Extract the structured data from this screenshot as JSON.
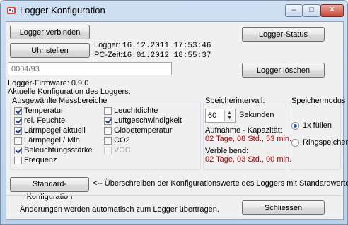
{
  "window": {
    "title": "Logger Konfiguration",
    "minimize_label": "–",
    "maximize_label": "□",
    "close_label": "✕"
  },
  "connect_button": "Logger verbinden",
  "status_button": "Logger-Status",
  "set_clock_button": "Uhr stellen",
  "clock": {
    "logger_label": "Logger:",
    "logger_value": "16.12.2011 17:53:46",
    "pc_label": "PC-Zeit:",
    "pc_value": "16.01.2012 18:55:37"
  },
  "id_field": {
    "value": "0004/93"
  },
  "clear_button": "Logger löschen",
  "firmware": "Logger-Firmware: 0.9.0",
  "config_label": "Aktuelle Konfiguration des Loggers:",
  "measurement": {
    "title": "Ausgewählte Messbereiche",
    "left": [
      {
        "label": "Temperatur",
        "checked": true
      },
      {
        "label": "rel. Feuchte",
        "checked": true
      },
      {
        "label": "Lärmpegel aktuell",
        "checked": true
      },
      {
        "label": "Lärmpegel / Min",
        "checked": false
      },
      {
        "label": "Beleuchtungsstärke",
        "checked": true
      },
      {
        "label": "Frequenz",
        "checked": false
      }
    ],
    "right": [
      {
        "label": "Leuchtdichte",
        "checked": false,
        "disabled": false
      },
      {
        "label": "Luftgeschwindigkeit",
        "checked": true,
        "disabled": false
      },
      {
        "label": "Globetemperatur",
        "checked": false,
        "disabled": false
      },
      {
        "label": "CO2",
        "checked": false,
        "disabled": false
      },
      {
        "label": "VOC",
        "checked": false,
        "disabled": true
      }
    ]
  },
  "interval": {
    "title": "Speicherintervall:",
    "value": "60",
    "unit": "Sekunden",
    "capacity_label": "Aufnahme - Kapazität:",
    "capacity_value": "02 Tage, 08 Std., 53 min.",
    "remaining_label": "Verbleibend:",
    "remaining_value": "02 Tage, 03 Std., 00 min."
  },
  "mode": {
    "title": "Speichermodus",
    "options": [
      {
        "label": "1x füllen",
        "selected": true
      },
      {
        "label": "Ringspeicher",
        "selected": false
      }
    ]
  },
  "defaults_button": "Standard-Konfiguration",
  "defaults_hint": "<-- Überschreiben der Konfigurationswerte des Loggers mit Standardwerten.",
  "footer_text": "Änderungen werden automatisch zum Logger übertragen.",
  "close_button": "Schliessen"
}
